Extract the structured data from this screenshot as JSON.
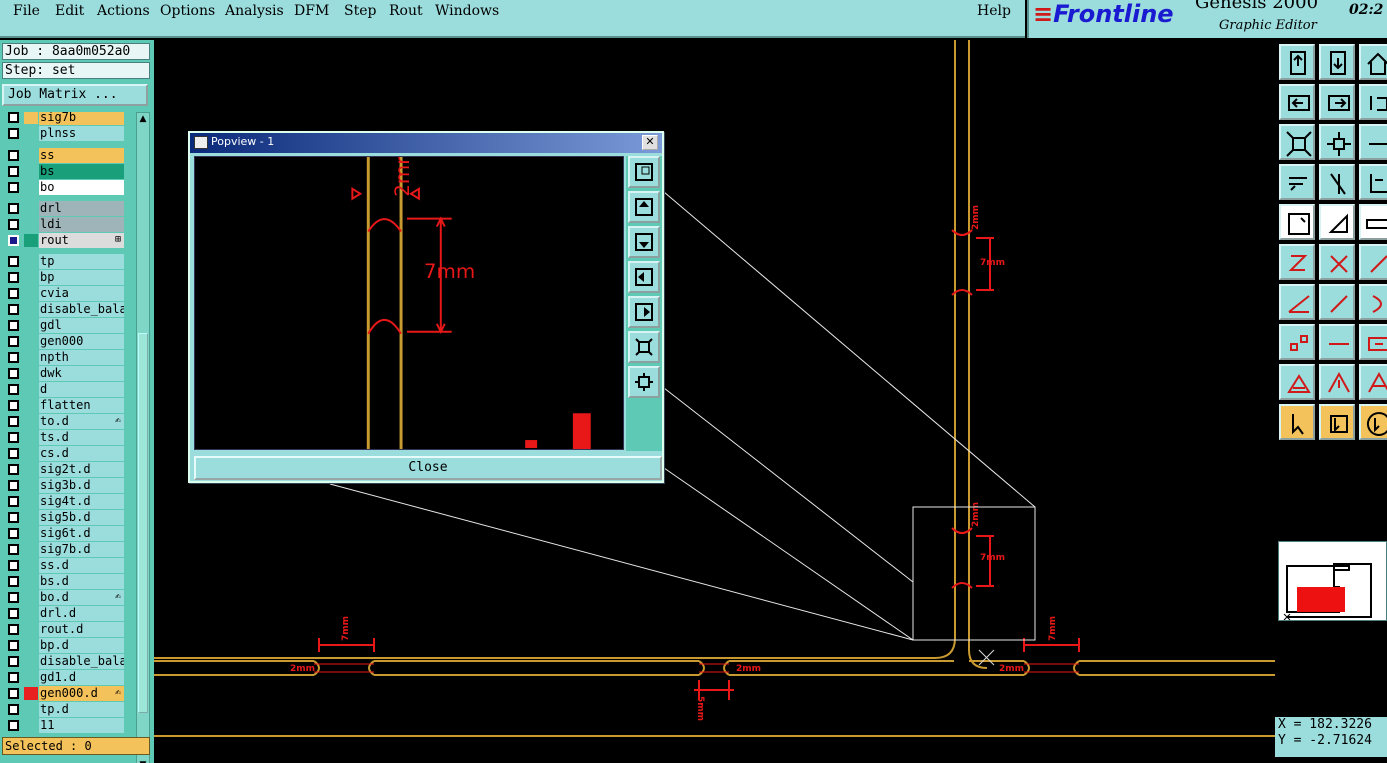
{
  "menu": {
    "items": [
      "File",
      "Edit",
      "Actions",
      "Options",
      "Analysis",
      "DFM",
      "Step",
      "Rout",
      "Windows"
    ],
    "help": "Help"
  },
  "brand": {
    "logo": "Frontline",
    "product": "Genesis 2000",
    "subtitle": "Graphic Editor",
    "clock": "02:2"
  },
  "job": {
    "job_label": "Job : 8aa0m052a0",
    "step_label": "Step: set",
    "matrix_button": "Job Matrix ..."
  },
  "layers": [
    {
      "name": "sig7b",
      "color": "#f4c25a",
      "bg": "#f4c25a"
    },
    {
      "name": "plnss",
      "color": "",
      "bg": "#9bdcdc"
    },
    {
      "name": "ss",
      "color": "",
      "bg": "#f4c25a"
    },
    {
      "name": "bs",
      "color": "",
      "bg": "#19a07a"
    },
    {
      "name": "bo",
      "color": "",
      "bg": "#ffffff"
    },
    {
      "name": "drl",
      "color": "",
      "bg": "#9fb4b8"
    },
    {
      "name": "ldi",
      "color": "",
      "bg": "#9fb4b8"
    },
    {
      "name": "rout",
      "color": "#19a07a",
      "bg": "#dcdcdc",
      "checked": true,
      "mark": "⊞"
    },
    {
      "name": "tp",
      "color": "",
      "bg": "#9bdcdc"
    },
    {
      "name": "bp",
      "color": "",
      "bg": "#9bdcdc"
    },
    {
      "name": "cvia",
      "color": "",
      "bg": "#9bdcdc"
    },
    {
      "name": "disable_bala",
      "color": "",
      "bg": "#9bdcdc"
    },
    {
      "name": "gdl",
      "color": "",
      "bg": "#9bdcdc"
    },
    {
      "name": "gen000",
      "color": "",
      "bg": "#9bdcdc"
    },
    {
      "name": "npth",
      "color": "",
      "bg": "#9bdcdc"
    },
    {
      "name": "dwk",
      "color": "",
      "bg": "#9bdcdc"
    },
    {
      "name": "d",
      "color": "",
      "bg": "#9bdcdc"
    },
    {
      "name": "flatten",
      "color": "",
      "bg": "#9bdcdc"
    },
    {
      "name": "to.d",
      "color": "",
      "bg": "#9bdcdc",
      "mark": "✍"
    },
    {
      "name": "ts.d",
      "color": "",
      "bg": "#9bdcdc"
    },
    {
      "name": "cs.d",
      "color": "",
      "bg": "#9bdcdc"
    },
    {
      "name": "sig2t.d",
      "color": "",
      "bg": "#9bdcdc"
    },
    {
      "name": "sig3b.d",
      "color": "",
      "bg": "#9bdcdc"
    },
    {
      "name": "sig4t.d",
      "color": "",
      "bg": "#9bdcdc"
    },
    {
      "name": "sig5b.d",
      "color": "",
      "bg": "#9bdcdc"
    },
    {
      "name": "sig6t.d",
      "color": "",
      "bg": "#9bdcdc"
    },
    {
      "name": "sig7b.d",
      "color": "",
      "bg": "#9bdcdc"
    },
    {
      "name": "ss.d",
      "color": "",
      "bg": "#9bdcdc"
    },
    {
      "name": "bs.d",
      "color": "",
      "bg": "#9bdcdc"
    },
    {
      "name": "bo.d",
      "color": "",
      "bg": "#9bdcdc",
      "mark": "✍"
    },
    {
      "name": "drl.d",
      "color": "",
      "bg": "#9bdcdc"
    },
    {
      "name": "rout.d",
      "color": "",
      "bg": "#9bdcdc"
    },
    {
      "name": "bp.d",
      "color": "",
      "bg": "#9bdcdc"
    },
    {
      "name": "disable_bala",
      "color": "",
      "bg": "#9bdcdc"
    },
    {
      "name": "gd1.d",
      "color": "",
      "bg": "#9bdcdc"
    },
    {
      "name": "gen000.d",
      "color": "#e82020",
      "bg": "#f4c25a",
      "mark": "✍"
    },
    {
      "name": "tp.d",
      "color": "",
      "bg": "#9bdcdc"
    },
    {
      "name": "11",
      "color": "",
      "bg": "#9bdcdc"
    }
  ],
  "status": {
    "selected": "Selected : 0",
    "x_coord": "X = 182.3226",
    "y_coord": "Y = -2.71624"
  },
  "popview": {
    "title": "Popview - 1",
    "close_label": "Close",
    "dim_2mm": "2mm",
    "dim_7mm": "7mm"
  },
  "canvas_labels": {
    "dim_2mm": "2mm",
    "dim_7mm": "7mm",
    "dim_5mm": "5mm"
  },
  "colors": {
    "trace": "#c89a30",
    "dimension": "#e81818",
    "panel": "#9bdcdc",
    "panel_dark": "#5ec9b5"
  }
}
